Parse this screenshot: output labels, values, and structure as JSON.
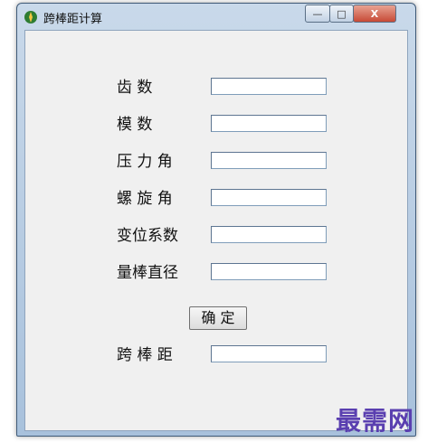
{
  "window": {
    "title": "跨棒距计算",
    "controls": {
      "minimize": "—",
      "maximize": "□",
      "close": "X"
    }
  },
  "form": {
    "fields": [
      {
        "label": "齿      数",
        "value": ""
      },
      {
        "label": "模      数",
        "value": ""
      },
      {
        "label": "压 力 角",
        "value": ""
      },
      {
        "label": "螺 旋 角",
        "value": ""
      },
      {
        "label": "变位系数",
        "value": ""
      },
      {
        "label": "量棒直径",
        "value": ""
      }
    ],
    "confirm_label": "确  定",
    "result": {
      "label": "跨 棒 距",
      "value": ""
    }
  },
  "watermark": "最需网",
  "colors": {
    "watermark": "#5a3fb0",
    "close_button": "#c74a36"
  }
}
